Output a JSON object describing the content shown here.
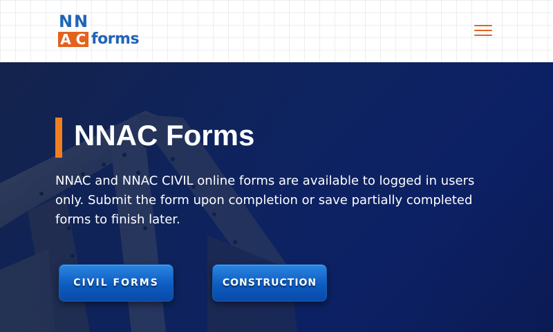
{
  "header": {
    "logo": {
      "letters": [
        "N",
        "N",
        "A",
        "C"
      ],
      "word": "forms",
      "colors": {
        "blue": "#1f64b6",
        "orange": "#e2621f"
      }
    },
    "menu_icon": "hamburger-menu-icon"
  },
  "hero": {
    "title": "NNAC Forms",
    "description": "NNAC and NNAC CIVIL online forms are available to logged in users only. Submit the form upon completion or save partially completed forms to finish later.",
    "buttons": [
      {
        "label": "CIVIL FORMS"
      },
      {
        "label": "CONSTRUCTION"
      }
    ],
    "accent_color": "#f0801f",
    "button_color": "#0d5cc2"
  }
}
